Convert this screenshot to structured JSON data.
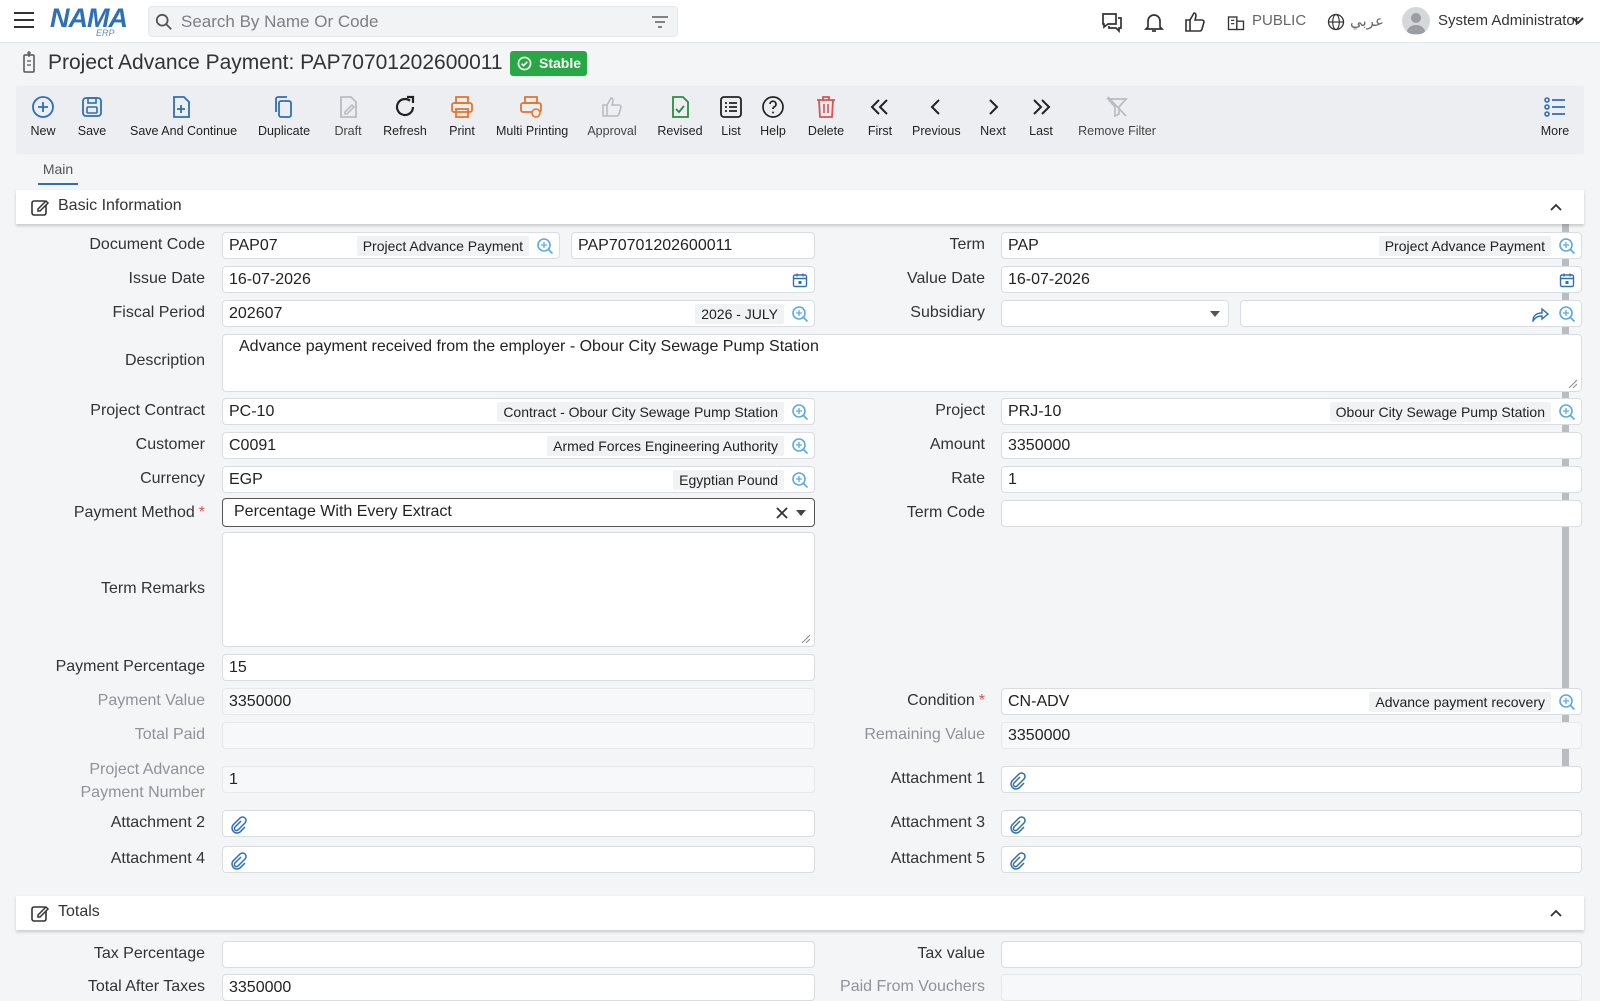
{
  "topbar": {
    "search_placeholder": "Search By Name Or Code",
    "logo_main": "NAMA",
    "logo_sub": "ERP",
    "company": "PUBLIC",
    "language": "عربي",
    "user_name": "System Administrator"
  },
  "page": {
    "title": "Project Advance Payment: PAP70701202600011",
    "status": "Stable"
  },
  "toolbar": {
    "new": "New",
    "save": "Save",
    "save_continue": "Save And Continue",
    "duplicate": "Duplicate",
    "draft": "Draft",
    "refresh": "Refresh",
    "print": "Print",
    "multi_printing": "Multi Printing",
    "approval": "Approval",
    "revised": "Revised",
    "list": "List",
    "help": "Help",
    "delete": "Delete",
    "first": "First",
    "previous": "Previous",
    "next": "Next",
    "last": "Last",
    "remove_filter": "Remove Filter",
    "more": "More"
  },
  "tabs": {
    "main": "Main"
  },
  "basic": {
    "title": "Basic Information",
    "document_code": {
      "label": "Document Code",
      "code": "PAP07",
      "desc": "Project Advance Payment",
      "number": "PAP70701202600011"
    },
    "term": {
      "label": "Term",
      "code": "PAP",
      "desc": "Project Advance Payment"
    },
    "issue_date": {
      "label": "Issue Date",
      "value": "16-07-2026"
    },
    "value_date": {
      "label": "Value Date",
      "value": "16-07-2026"
    },
    "fiscal_period": {
      "label": "Fiscal Period",
      "code": "202607",
      "desc": "2026 - JULY"
    },
    "subsidiary": {
      "label": "Subsidiary"
    },
    "description": {
      "label": "Description",
      "value": "Advance payment received from the employer - Obour City Sewage Pump Station"
    },
    "project_contract": {
      "label": "Project Contract",
      "code": "PC-10",
      "desc": "Contract - Obour City Sewage Pump Station"
    },
    "project": {
      "label": "Project",
      "code": "PRJ-10",
      "desc": "Obour City Sewage Pump Station"
    },
    "customer": {
      "label": "Customer",
      "code": "C0091",
      "desc": "Armed Forces Engineering Authority"
    },
    "amount": {
      "label": "Amount",
      "value": "3350000"
    },
    "currency": {
      "label": "Currency",
      "code": "EGP",
      "desc": "Egyptian Pound"
    },
    "rate": {
      "label": "Rate",
      "value": "1"
    },
    "payment_method": {
      "label": "Payment Method",
      "value": "Percentage With Every Extract"
    },
    "term_code": {
      "label": "Term Code"
    },
    "term_remarks": {
      "label": "Term Remarks"
    },
    "payment_percentage": {
      "label": "Payment Percentage",
      "value": "15"
    },
    "payment_value": {
      "label": "Payment Value",
      "value": "3350000"
    },
    "condition": {
      "label": "Condition",
      "code": "CN-ADV",
      "desc": "Advance payment recovery"
    },
    "total_paid": {
      "label": "Total Paid"
    },
    "remaining_value": {
      "label": "Remaining Value",
      "value": "3350000"
    },
    "advance_number": {
      "label_1": "Project Advance",
      "label_2": "Payment Number",
      "value": "1"
    },
    "attachment_1": "Attachment 1",
    "attachment_2": "Attachment 2",
    "attachment_3": "Attachment 3",
    "attachment_4": "Attachment 4",
    "attachment_5": "Attachment 5"
  },
  "totals": {
    "title": "Totals",
    "tax_percentage": "Tax Percentage",
    "tax_value": "Tax value",
    "total_after_taxes": {
      "label": "Total After Taxes",
      "value": "3350000"
    },
    "paid_from_vouchers": "Paid From Vouchers"
  },
  "colors": {
    "accent": "#2e6fb5",
    "stable": "#28a745",
    "print": "#e8742a",
    "revised": "#2f8a3f",
    "delete": "#d9534f",
    "required": "#d9534f"
  }
}
